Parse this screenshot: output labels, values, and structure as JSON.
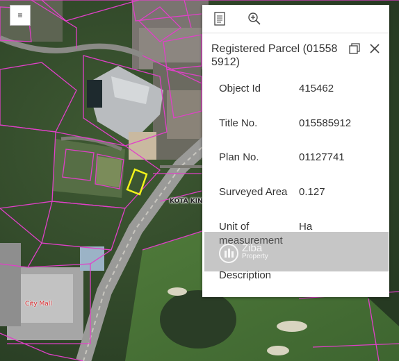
{
  "map": {
    "labels": {
      "road": "KOTA KIN",
      "mall": "City Mall"
    }
  },
  "menu": {
    "icon": "hamburger-menu-icon",
    "glyph": "≡"
  },
  "popup": {
    "toolbar": {
      "icons": [
        "document-icon",
        "zoom-to-icon"
      ]
    },
    "title": "Registered Parcel (01558 5912)",
    "header_icons": [
      "dock-icon",
      "close-icon"
    ],
    "attributes": [
      {
        "key": "Object Id",
        "value": "415462"
      },
      {
        "key": "Title No.",
        "value": "015585912"
      },
      {
        "key": "Plan No.",
        "value": "01127741"
      },
      {
        "key": "Surveyed Area",
        "value": "0.127"
      },
      {
        "key": "Unit of measurement",
        "value": "Ha"
      },
      {
        "key": "Description",
        "value": ""
      }
    ]
  },
  "watermark": {
    "line1": "Ziba",
    "line2": "Property"
  },
  "colors": {
    "parcel_outline": "#e040c8",
    "selected_parcel": "#f2f21a",
    "road": "#9a9a98",
    "vegetation": "#2f4a28"
  }
}
